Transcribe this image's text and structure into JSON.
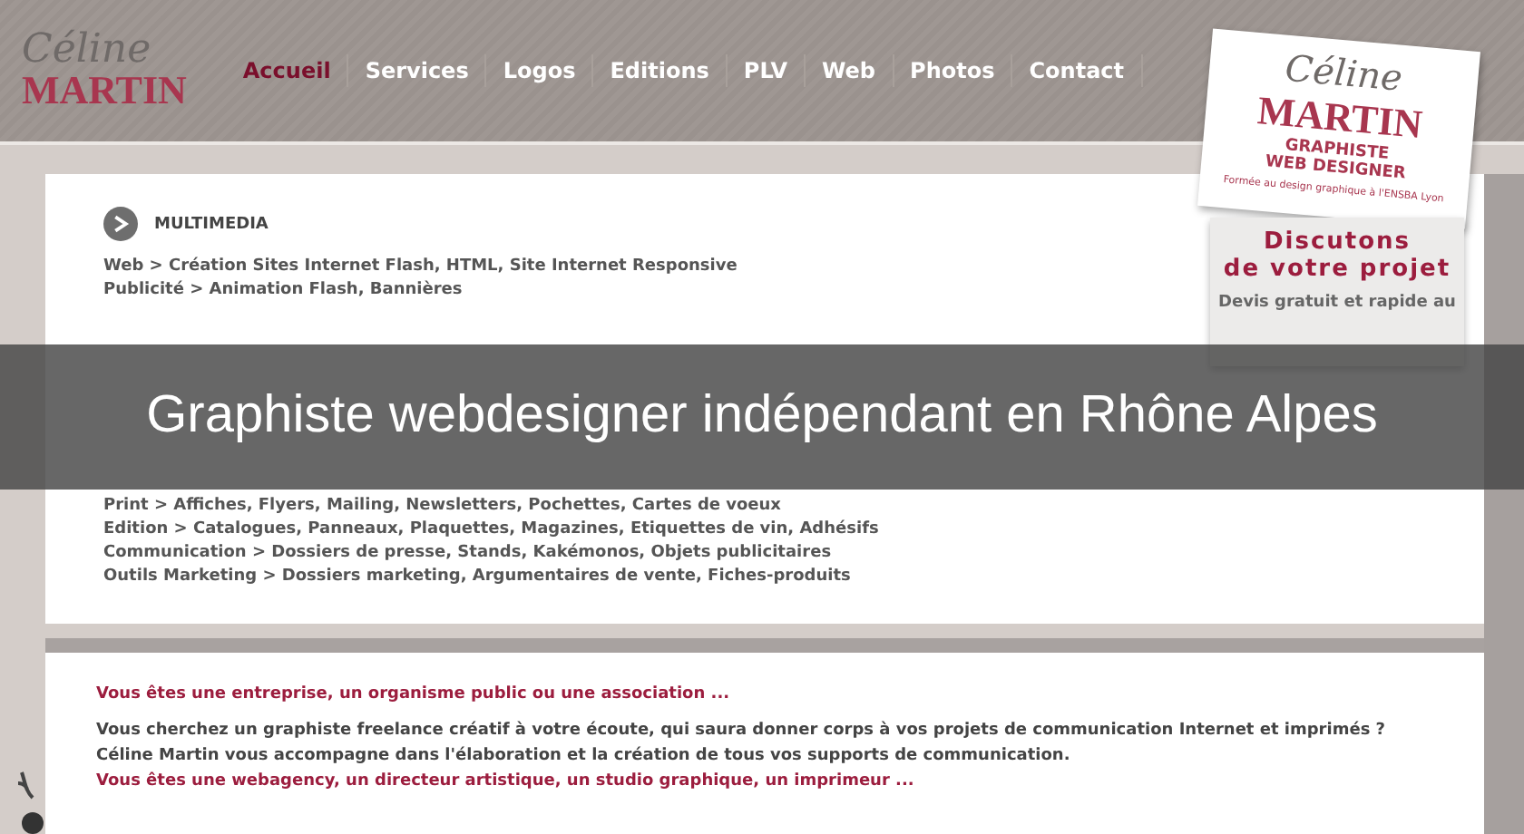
{
  "logo": {
    "script": "Céline",
    "name": "MARTIN"
  },
  "nav": [
    {
      "label": "Accueil",
      "selected": true
    },
    {
      "label": "Services",
      "selected": false
    },
    {
      "label": "Logos",
      "selected": false
    },
    {
      "label": "Editions",
      "selected": false
    },
    {
      "label": "PLV",
      "selected": false
    },
    {
      "label": "Web",
      "selected": false
    },
    {
      "label": "Photos",
      "selected": false
    },
    {
      "label": "Contact",
      "selected": false
    }
  ],
  "card": {
    "script": "Céline",
    "name": "MARTIN",
    "role": [
      "GRAPHISTE",
      "WEB DESIGNER"
    ],
    "tagline": "Formée au design graphique à l'ENSBA Lyon"
  },
  "cta": {
    "title": [
      "Discutons",
      "de votre projet"
    ],
    "text": "Devis gratuit et rapide au"
  },
  "services": [
    {
      "heading": "MULTIMEDIA",
      "lines": [
        "Web > Création Sites Internet Flash, HTML, Site Internet Responsive",
        "Publicité > Animation Flash, Bannières"
      ]
    },
    {
      "lines": [
        "Print > Affiches, Flyers, Mailing, Newsletters, Pochettes, Cartes de voeux",
        "Edition > Catalogues, Panneaux, Plaquettes, Magazines, Etiquettes de vin, Adhésifs",
        "Communication > Dossiers de presse, Stands, Kakémonos, Objets publicitaires",
        "Outils Marketing > Dossiers marketing, Argumentaires de vente, Fiches-produits"
      ]
    }
  ],
  "intro": [
    {
      "kind": "heading",
      "text": "Vous êtes une entreprise, un organisme public ou une association ..."
    },
    {
      "kind": "body",
      "text": "Vous cherchez un graphiste freelance créatif à votre écoute, qui saura donner corps à vos projets de communication Internet et imprimés ?"
    },
    {
      "kind": "body",
      "text": "Céline Martin vous accompagne dans l'élaboration et la création de tous vos supports de communication."
    },
    {
      "kind": "heading",
      "text": "Vous êtes une webagency, un directeur artistique, un studio graphique, un imprimeur ..."
    }
  ],
  "caption": "Graphiste webdesigner indépendant en Rhône Alpes"
}
